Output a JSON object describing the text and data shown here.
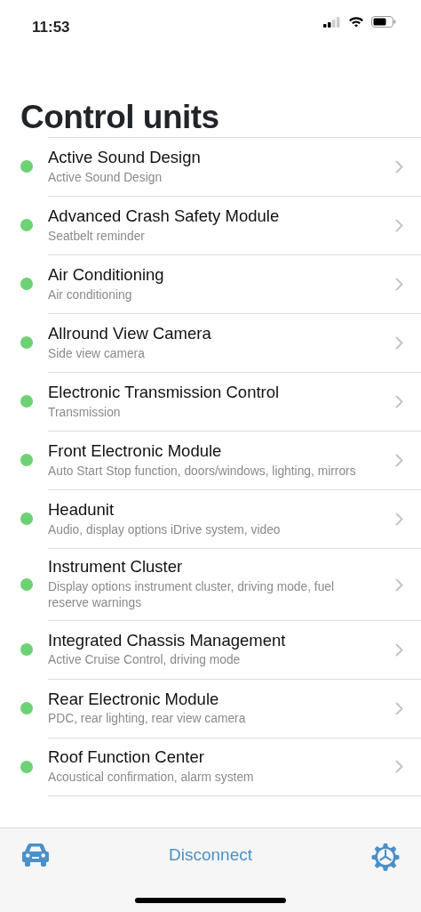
{
  "status_bar": {
    "time": "11:53"
  },
  "title": "Control units",
  "units": [
    {
      "name": "Active Sound Design",
      "description": "Active Sound Design",
      "color": "#6dd274"
    },
    {
      "name": "Advanced Crash Safety Module",
      "description": "Seatbelt reminder",
      "color": "#6dd274"
    },
    {
      "name": "Air Conditioning",
      "description": "Air conditioning",
      "color": "#6dd274"
    },
    {
      "name": "Allround View Camera",
      "description": "Side view camera",
      "color": "#6dd274"
    },
    {
      "name": "Electronic Transmission Control",
      "description": "Transmission",
      "color": "#6dd274"
    },
    {
      "name": "Front Electronic Module",
      "description": "Auto Start Stop function, doors/windows, lighting, mirrors",
      "color": "#6dd274"
    },
    {
      "name": "Headunit",
      "description": "Audio, display options iDrive system, video",
      "color": "#6dd274"
    },
    {
      "name": "Instrument Cluster",
      "description": "Display options instrument cluster, driving mode, fuel reserve warnings",
      "color": "#6dd274"
    },
    {
      "name": "Integrated Chassis Management",
      "description": "Active Cruise Control, driving mode",
      "color": "#6dd274"
    },
    {
      "name": "Rear Electronic Module",
      "description": "PDC, rear lighting, rear view camera",
      "color": "#6dd274"
    },
    {
      "name": "Roof Function Center",
      "description": "Acoustical confirmation, alarm system",
      "color": "#6dd274"
    }
  ],
  "tab_bar": {
    "action": "Disconnect"
  }
}
